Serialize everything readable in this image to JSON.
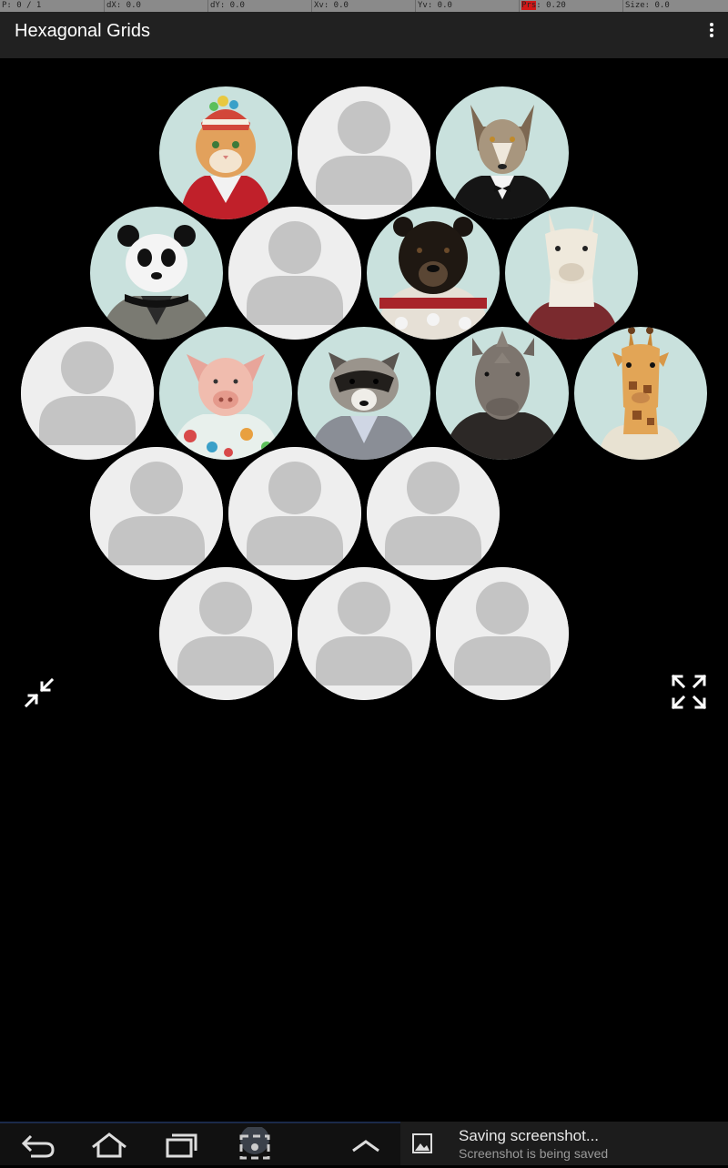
{
  "debug_bar": {
    "pointer": "P: 0 / 1",
    "dx": "dX: 0.0",
    "dy": "dY: 0.0",
    "xv": "Xv: 0.0",
    "yv": "Yv: 0.0",
    "prs_label": "Prs",
    "prs_value": ": 0.20",
    "size": "Size: 0.0"
  },
  "app": {
    "title": "Hexagonal Grids",
    "menu_icon": "overflow-menu-icon"
  },
  "grid": {
    "items": [
      {
        "kind": "cat"
      },
      {
        "kind": "placeholder"
      },
      {
        "kind": "wolf"
      },
      {
        "kind": "panda"
      },
      {
        "kind": "placeholder"
      },
      {
        "kind": "bear"
      },
      {
        "kind": "llama"
      },
      {
        "kind": "placeholder"
      },
      {
        "kind": "pig"
      },
      {
        "kind": "raccoon"
      },
      {
        "kind": "rhino"
      },
      {
        "kind": "giraffe"
      },
      {
        "kind": "placeholder"
      },
      {
        "kind": "placeholder"
      },
      {
        "kind": "placeholder"
      },
      {
        "kind": "placeholder"
      },
      {
        "kind": "placeholder"
      },
      {
        "kind": "placeholder"
      }
    ]
  },
  "controls": {
    "shrink_icon": "shrink-arrows-icon",
    "expand_icon": "expand-arrows-icon"
  },
  "nav": {
    "back": "back-icon",
    "home": "home-icon",
    "recents": "recents-icon",
    "screenshot": "screenshot-icon",
    "up": "chevron-up-icon"
  },
  "notification": {
    "title": "Saving screenshot...",
    "subtitle": "Screenshot is being saved",
    "icon": "image-icon"
  },
  "colors": {
    "background": "#000000",
    "app_bar": "#212121",
    "placeholder": "#eeeeee",
    "silhouette": "#c4c4c4",
    "portrait_bg": "#c8e0dc"
  }
}
